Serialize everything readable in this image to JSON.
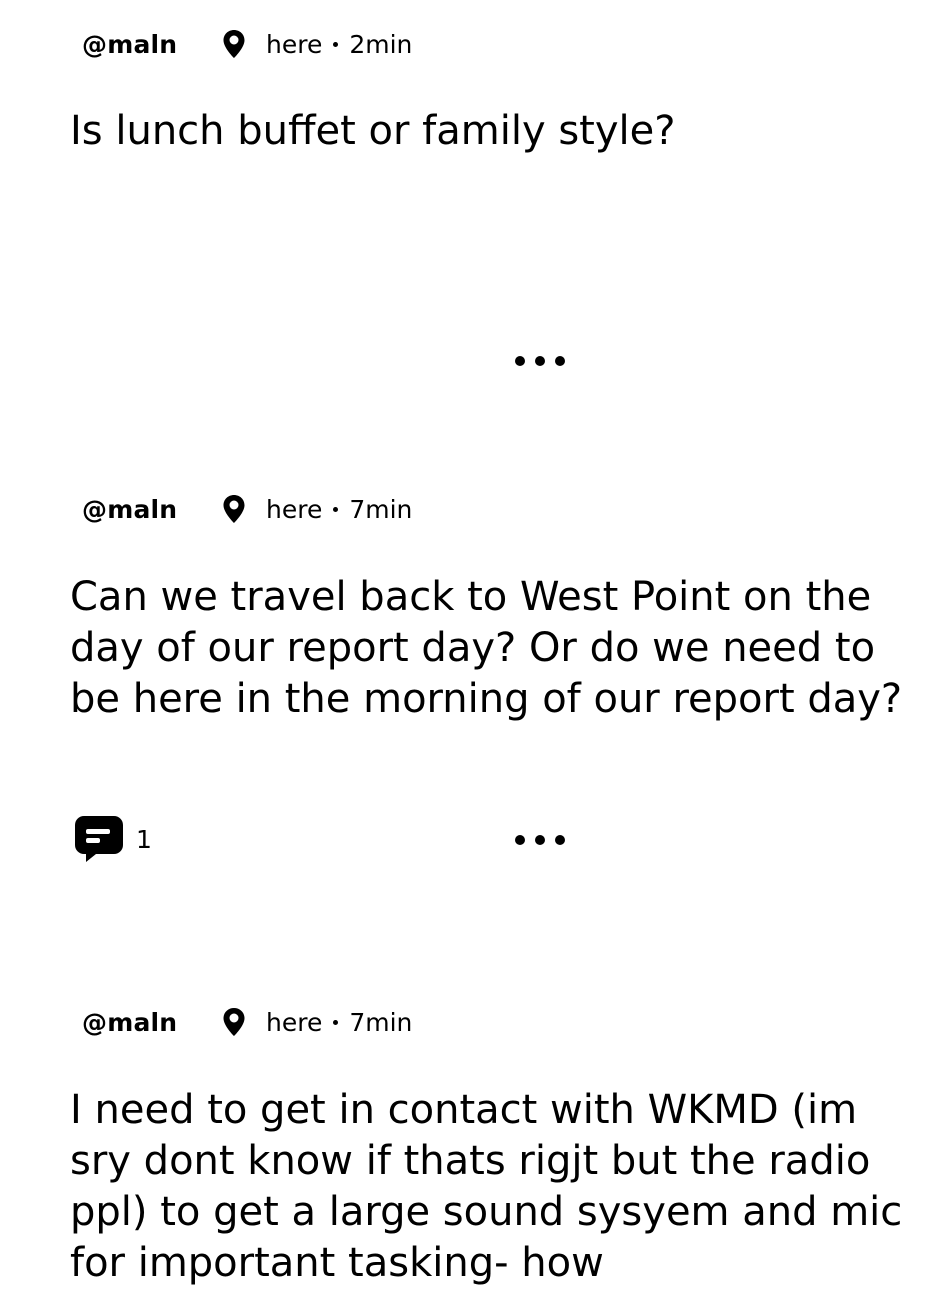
{
  "posts": [
    {
      "handle": "@maln",
      "location": "here",
      "age": "2min",
      "text": "Is lunch buffet or family style?",
      "replies": null
    },
    {
      "handle": "@maln",
      "location": "here",
      "age": "7min",
      "text": "Can we travel back to West Point on the day of our report day? Or do we need to be here in the morning of our report day?",
      "replies": "1"
    },
    {
      "handle": "@maln",
      "location": "here",
      "age": "7min",
      "text": "I need to get in contact with WKMD (im sry dont know if thats rigjt but the radio ppl) to get a large sound sysyem and mic for important tasking- how",
      "replies": null
    }
  ],
  "icons": {
    "location": "map-pin-icon",
    "reply": "chat-bubble-icon",
    "more": "more-options-icon"
  }
}
